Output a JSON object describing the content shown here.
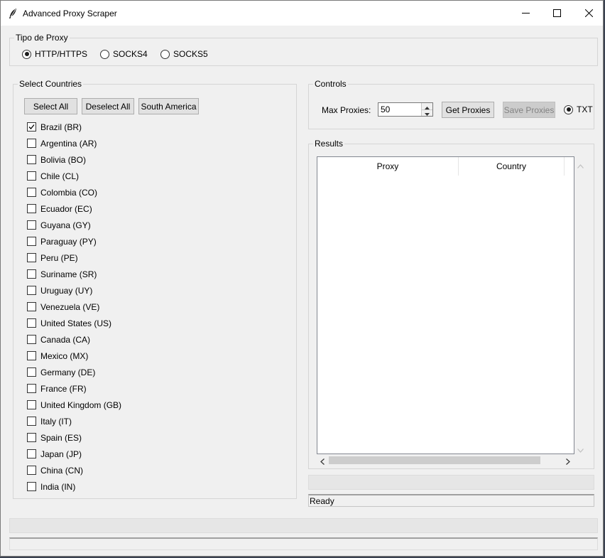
{
  "window": {
    "title": "Advanced Proxy Scraper",
    "controls": [
      "minimize-icon",
      "maximize-icon",
      "close-icon"
    ]
  },
  "proxy_type": {
    "label": "Tipo de Proxy",
    "options": [
      "HTTP/HTTPS",
      "SOCKS4",
      "SOCKS5"
    ],
    "selected": "HTTP/HTTPS"
  },
  "countries": {
    "label": "Select Countries",
    "buttons": {
      "select_all": "Select All",
      "deselect_all": "Deselect All",
      "south_america": "South America"
    },
    "items": [
      {
        "label": "Brazil (BR)",
        "checked": true
      },
      {
        "label": "Argentina (AR)",
        "checked": false
      },
      {
        "label": "Bolivia (BO)",
        "checked": false
      },
      {
        "label": "Chile (CL)",
        "checked": false
      },
      {
        "label": "Colombia (CO)",
        "checked": false
      },
      {
        "label": "Ecuador (EC)",
        "checked": false
      },
      {
        "label": "Guyana (GY)",
        "checked": false
      },
      {
        "label": "Paraguay (PY)",
        "checked": false
      },
      {
        "label": "Peru (PE)",
        "checked": false
      },
      {
        "label": "Suriname (SR)",
        "checked": false
      },
      {
        "label": "Uruguay (UY)",
        "checked": false
      },
      {
        "label": "Venezuela (VE)",
        "checked": false
      },
      {
        "label": "United States (US)",
        "checked": false
      },
      {
        "label": "Canada (CA)",
        "checked": false
      },
      {
        "label": "Mexico (MX)",
        "checked": false
      },
      {
        "label": "Germany (DE)",
        "checked": false
      },
      {
        "label": "France (FR)",
        "checked": false
      },
      {
        "label": "United Kingdom (GB)",
        "checked": false
      },
      {
        "label": "Italy (IT)",
        "checked": false
      },
      {
        "label": "Spain (ES)",
        "checked": false
      },
      {
        "label": "Japan (JP)",
        "checked": false
      },
      {
        "label": "China (CN)",
        "checked": false
      },
      {
        "label": "India (IN)",
        "checked": false
      }
    ]
  },
  "controls": {
    "label": "Controls",
    "max_proxies_label": "Max Proxies:",
    "max_proxies_value": "50",
    "get_proxies": "Get Proxies",
    "save_proxies": "Save Proxies",
    "save_proxies_enabled": false,
    "format_option": "TXT",
    "format_selected": true
  },
  "results": {
    "label": "Results",
    "columns": [
      "Proxy",
      "Country"
    ],
    "rows": []
  },
  "status": {
    "text": "Ready"
  }
}
